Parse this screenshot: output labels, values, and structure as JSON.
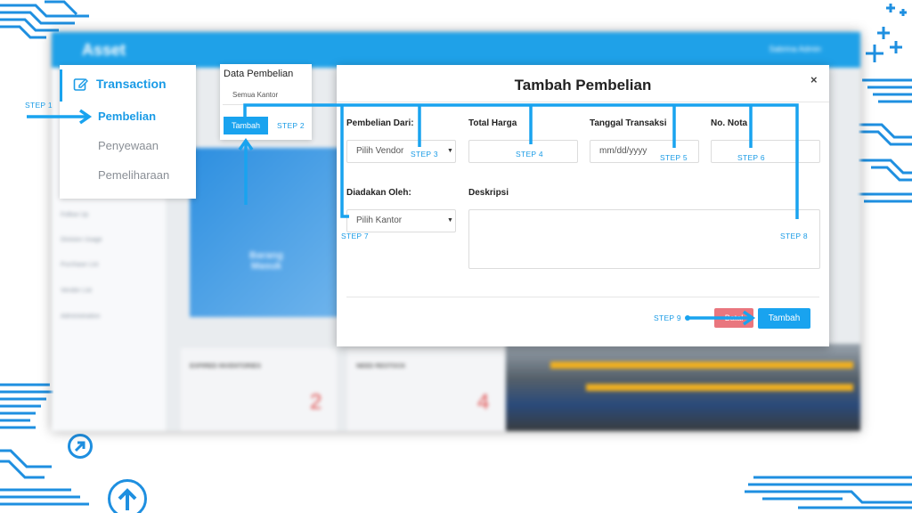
{
  "background_app": {
    "logo": "Asset",
    "user_name": "Sabrina Admin",
    "sidebar_items": [
      "Follow Up",
      "Division Usage",
      "Purchase List",
      "Vendor List",
      "Administration"
    ],
    "banner_text": "Barang Masuk",
    "cards": [
      {
        "title": "EXPIRED INVENTORIES",
        "count": "2"
      },
      {
        "title": "NEED RESTOCK",
        "count": "4"
      }
    ]
  },
  "menu": {
    "heading": "Transaction",
    "items": [
      {
        "label": "Pembelian",
        "active": true
      },
      {
        "label": "Penyewaan",
        "active": false
      },
      {
        "label": "Pemeliharaan",
        "active": false
      }
    ]
  },
  "data_pembelian": {
    "title": "Data Pembelian",
    "filter": "Semua Kantor",
    "add_button": "Tambah"
  },
  "modal": {
    "title": "Tambah Pembelian",
    "close": "×",
    "fields": {
      "pembelian_dari": {
        "label": "Pembelian Dari:",
        "value": "Pilih Vendor"
      },
      "total_harga": {
        "label": "Total Harga",
        "value": ""
      },
      "tanggal_transaksi": {
        "label": "Tanggal Transaksi",
        "placeholder": "mm/dd/yyyy"
      },
      "no_nota": {
        "label": "No. Nota",
        "value": ""
      },
      "diadakan_oleh": {
        "label": "Diadakan Oleh:",
        "value": "Pilih Kantor"
      },
      "deskripsi": {
        "label": "Deskripsi",
        "value": ""
      }
    },
    "cancel_button": "Batal",
    "submit_button": "Tambah"
  },
  "steps": {
    "s1": "STEP 1",
    "s2": "STEP 2",
    "s3": "STEP 3",
    "s4": "STEP 4",
    "s5": "STEP 5",
    "s6": "STEP 6",
    "s7": "STEP 7",
    "s8": "STEP 8",
    "s9": "STEP 9"
  },
  "colors": {
    "accent": "#19a3ef",
    "danger": "#e9767e",
    "deco": "#1e8fe0"
  }
}
